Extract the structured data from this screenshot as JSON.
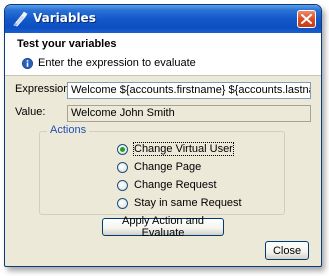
{
  "window": {
    "title": "Variables"
  },
  "header": {
    "title": "Test your variables",
    "message": "Enter the expression to evaluate"
  },
  "form": {
    "expression_label": "Expression:",
    "expression_value": "Welcome ${accounts.firstname} ${accounts.lastname}",
    "value_label": "Value:",
    "value_text": "Welcome John Smith"
  },
  "actions": {
    "legend": "Actions",
    "options": [
      {
        "label": "Change Virtual User",
        "checked": true
      },
      {
        "label": "Change Page",
        "checked": false
      },
      {
        "label": "Change Request",
        "checked": false
      },
      {
        "label": "Stay in same Request",
        "checked": false
      }
    ]
  },
  "buttons": {
    "apply_label": "Apply Action and Evaluate",
    "close_label": "Close"
  }
}
